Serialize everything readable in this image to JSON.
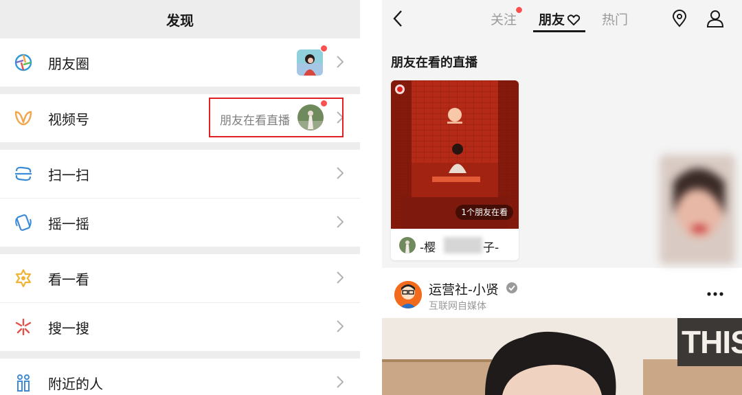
{
  "left": {
    "title": "发现",
    "items": [
      {
        "label": "朋友圈",
        "icon": "moments-icon"
      },
      {
        "label": "视频号",
        "icon": "channels-icon",
        "sub": "朋友在看直播"
      },
      {
        "label": "扫一扫",
        "icon": "scan-icon"
      },
      {
        "label": "摇一摇",
        "icon": "shake-icon"
      },
      {
        "label": "看一看",
        "icon": "top-stories-icon"
      },
      {
        "label": "搜一搜",
        "icon": "search-icon"
      },
      {
        "label": "附近的人",
        "icon": "people-nearby-icon"
      }
    ]
  },
  "right": {
    "tabs": [
      "关注",
      "朋友",
      "热门"
    ],
    "active_tab": "朋友",
    "section_title": "朋友在看的直播",
    "live_card": {
      "badge": "1个朋友在看",
      "name_start": "-樱",
      "name_end": "子-"
    },
    "author": {
      "name": "运营社-小贤",
      "subtitle": "互联网自媒体"
    },
    "preview_text": "THIS"
  },
  "colors": {
    "background_gray": "#ededed",
    "red_dot": "#fa5151",
    "highlight_box": "#e02020",
    "verified_gray": "#9a9a9a"
  }
}
